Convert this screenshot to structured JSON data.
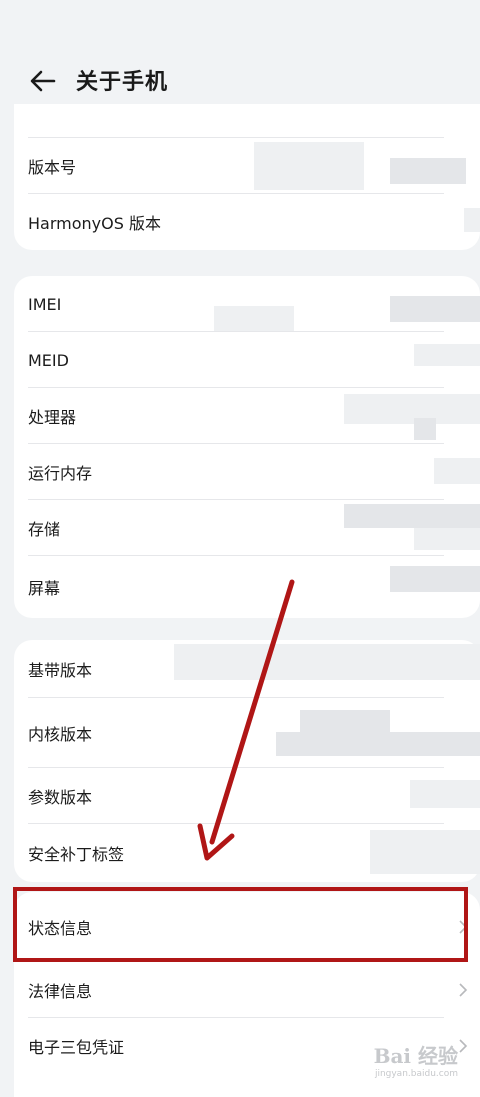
{
  "header": {
    "title": "关于手机"
  },
  "sections": [
    {
      "rows": [
        {
          "label": "版本号"
        },
        {
          "label": "HarmonyOS 版本"
        }
      ]
    },
    {
      "rows": [
        {
          "label": "IMEI"
        },
        {
          "label": "MEID"
        },
        {
          "label": "处理器"
        },
        {
          "label": "运行内存"
        },
        {
          "label": "存储"
        },
        {
          "label": "屏幕"
        }
      ]
    },
    {
      "rows": [
        {
          "label": "基带版本"
        },
        {
          "label": "内核版本"
        },
        {
          "label": "参数版本"
        },
        {
          "label": "安全补丁标签"
        }
      ]
    },
    {
      "rows": [
        {
          "label": "状态信息"
        },
        {
          "label": "法律信息"
        },
        {
          "label": "电子三包凭证"
        }
      ]
    }
  ],
  "watermark": {
    "brand": "Bai 经验",
    "url": "jingyan.baidu.com"
  },
  "colors": {
    "highlight": "#b01616",
    "background": "#f1f3f5"
  }
}
